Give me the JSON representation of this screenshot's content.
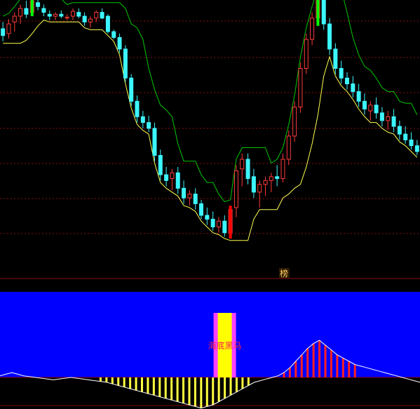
{
  "chart_data": [
    {
      "type": "candlestick",
      "panel": "price",
      "title": "",
      "grid": true,
      "colors": {
        "up_candle": "#ff3b3b",
        "down_candle": "#3cf6ff",
        "upper_band": "#00c800",
        "lower_band": "#ffff50",
        "grid": "#8a1010",
        "signal_top": "#00ff00",
        "signal_bottom": "#ff0000"
      },
      "marker_label": "榜",
      "candles": [
        {
          "o": 45,
          "h": 52,
          "l": 32,
          "c": 38
        },
        {
          "o": 40,
          "h": 55,
          "l": 35,
          "c": 50
        },
        {
          "o": 52,
          "h": 62,
          "l": 42,
          "c": 58
        },
        {
          "o": 58,
          "h": 70,
          "l": 50,
          "c": 66
        },
        {
          "o": 66,
          "h": 74,
          "l": 56,
          "c": 60
        },
        {
          "o": 62,
          "h": 78,
          "l": 58,
          "c": 74
        },
        {
          "o": 72,
          "h": 80,
          "l": 64,
          "c": 68
        },
        {
          "o": 66,
          "h": 70,
          "l": 58,
          "c": 62
        },
        {
          "o": 60,
          "h": 64,
          "l": 54,
          "c": 58
        },
        {
          "o": 58,
          "h": 62,
          "l": 54,
          "c": 60
        },
        {
          "o": 60,
          "h": 64,
          "l": 56,
          "c": 58
        },
        {
          "o": 56,
          "h": 60,
          "l": 54,
          "c": 57
        },
        {
          "o": 58,
          "h": 66,
          "l": 54,
          "c": 63
        },
        {
          "o": 62,
          "h": 66,
          "l": 56,
          "c": 58
        },
        {
          "o": 58,
          "h": 62,
          "l": 48,
          "c": 52
        },
        {
          "o": 52,
          "h": 58,
          "l": 46,
          "c": 55
        },
        {
          "o": 56,
          "h": 64,
          "l": 52,
          "c": 62
        },
        {
          "o": 62,
          "h": 66,
          "l": 55,
          "c": 56
        },
        {
          "o": 58,
          "h": 60,
          "l": 40,
          "c": 42
        },
        {
          "o": 42,
          "h": 44,
          "l": 34,
          "c": 36
        },
        {
          "o": 36,
          "h": 40,
          "l": 20,
          "c": 24
        },
        {
          "o": 24,
          "h": 28,
          "l": -10,
          "c": -6
        },
        {
          "o": -6,
          "h": -2,
          "l": -35,
          "c": -30
        },
        {
          "o": -30,
          "h": -24,
          "l": -52,
          "c": -46
        },
        {
          "o": -46,
          "h": -40,
          "l": -58,
          "c": -52
        },
        {
          "o": -52,
          "h": -45,
          "l": -62,
          "c": -58
        },
        {
          "o": -58,
          "h": -52,
          "l": -92,
          "c": -86
        },
        {
          "o": -86,
          "h": -80,
          "l": -112,
          "c": -106
        },
        {
          "o": -106,
          "h": -98,
          "l": -118,
          "c": -112
        },
        {
          "o": -110,
          "h": -100,
          "l": -122,
          "c": -104
        },
        {
          "o": -104,
          "h": -98,
          "l": -126,
          "c": -120
        },
        {
          "o": -120,
          "h": -112,
          "l": -136,
          "c": -130
        },
        {
          "o": -130,
          "h": -122,
          "l": -138,
          "c": -126
        },
        {
          "o": -126,
          "h": -120,
          "l": -142,
          "c": -136
        },
        {
          "o": -136,
          "h": -132,
          "l": -152,
          "c": -148
        },
        {
          "o": -148,
          "h": -140,
          "l": -158,
          "c": -152
        },
        {
          "o": -152,
          "h": -144,
          "l": -164,
          "c": -160
        },
        {
          "o": -160,
          "h": -150,
          "l": -166,
          "c": -154
        },
        {
          "o": -154,
          "h": -148,
          "l": -170,
          "c": -166
        },
        {
          "o": -166,
          "h": -138,
          "l": -172,
          "c": -142
        },
        {
          "o": -140,
          "h": -96,
          "l": -150,
          "c": -102
        },
        {
          "o": -100,
          "h": -84,
          "l": -118,
          "c": -90
        },
        {
          "o": -90,
          "h": -84,
          "l": -116,
          "c": -110
        },
        {
          "o": -108,
          "h": -100,
          "l": -130,
          "c": -124
        },
        {
          "o": -124,
          "h": -112,
          "l": -140,
          "c": -116
        },
        {
          "o": -116,
          "h": -108,
          "l": -128,
          "c": -112
        },
        {
          "o": -112,
          "h": -104,
          "l": -124,
          "c": -108
        },
        {
          "o": -108,
          "h": -96,
          "l": -118,
          "c": -110
        },
        {
          "o": -110,
          "h": -84,
          "l": -114,
          "c": -90
        },
        {
          "o": -90,
          "h": -60,
          "l": -96,
          "c": -66
        },
        {
          "o": -66,
          "h": -30,
          "l": -72,
          "c": -36
        },
        {
          "o": -36,
          "h": 10,
          "l": -42,
          "c": 4
        },
        {
          "o": 4,
          "h": 40,
          "l": -2,
          "c": 34
        },
        {
          "o": 34,
          "h": 62,
          "l": 28,
          "c": 56
        },
        {
          "o": 56,
          "h": 82,
          "l": 48,
          "c": 76
        },
        {
          "o": 76,
          "h": 80,
          "l": 44,
          "c": 50
        },
        {
          "o": 50,
          "h": 56,
          "l": 18,
          "c": 24
        },
        {
          "o": 24,
          "h": 30,
          "l": -2,
          "c": 4
        },
        {
          "o": 4,
          "h": 12,
          "l": -12,
          "c": -6
        },
        {
          "o": -6,
          "h": 0,
          "l": -18,
          "c": -12
        },
        {
          "o": -12,
          "h": -4,
          "l": -26,
          "c": -20
        },
        {
          "o": -20,
          "h": -12,
          "l": -36,
          "c": -30
        },
        {
          "o": -30,
          "h": -22,
          "l": -44,
          "c": -38
        },
        {
          "o": -40,
          "h": -30,
          "l": -50,
          "c": -34
        },
        {
          "o": -34,
          "h": -26,
          "l": -48,
          "c": -42
        },
        {
          "o": -42,
          "h": -36,
          "l": -56,
          "c": -50
        },
        {
          "o": -50,
          "h": -40,
          "l": -60,
          "c": -46
        },
        {
          "o": -46,
          "h": -38,
          "l": -62,
          "c": -56
        },
        {
          "o": -56,
          "h": -50,
          "l": -70,
          "c": -64
        },
        {
          "o": -64,
          "h": -56,
          "l": -74,
          "c": -70
        },
        {
          "o": -70,
          "h": -62,
          "l": -80,
          "c": -76
        },
        {
          "o": -76,
          "h": -70,
          "l": -86,
          "c": -82
        }
      ]
    },
    {
      "type": "area",
      "panel": "indicator",
      "title": "",
      "annotation": "海底黑马",
      "colors": {
        "background": "#0000ff",
        "line": "#ffffff",
        "positive_fill": "#ff2020",
        "negative_fill": "#ffff40",
        "signal_outer": "#ff40ff",
        "signal_inner": "#ffff00",
        "baseline": "#800000"
      },
      "signal_index": 38,
      "values": [
        2,
        4,
        6,
        4,
        2,
        1,
        0,
        -1,
        -2,
        -3,
        -2,
        -1,
        0,
        -1,
        -2,
        -3,
        -4,
        -5,
        -6,
        -8,
        -10,
        -12,
        -14,
        -16,
        -18,
        -20,
        -22,
        -24,
        -26,
        -28,
        -30,
        -32,
        -34,
        -36,
        -38,
        -36,
        -34,
        -30,
        -26,
        -22,
        -18,
        -14,
        -10,
        -6,
        -4,
        -2,
        0,
        2,
        6,
        12,
        20,
        28,
        36,
        42,
        46,
        40,
        34,
        28,
        24,
        20,
        16,
        14,
        12,
        10,
        8,
        6,
        4,
        2,
        0,
        -2,
        -4,
        -6
      ]
    }
  ]
}
